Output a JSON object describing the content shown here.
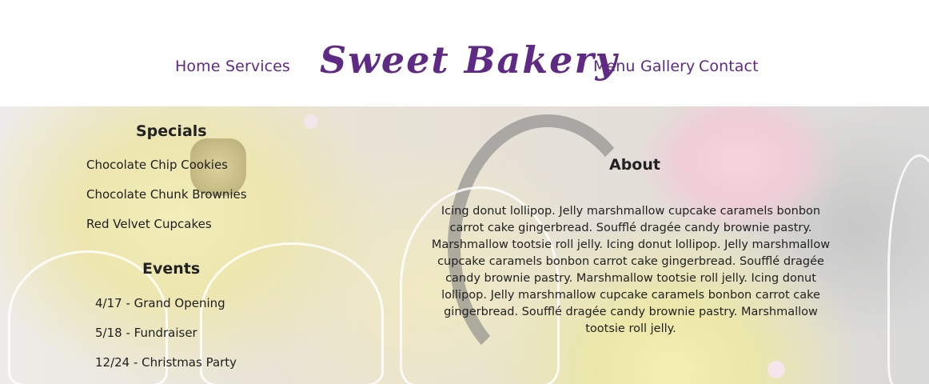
{
  "header": {
    "nav_left": [
      "Home",
      "Services"
    ],
    "brand": "Sweet Bakery",
    "nav_right": [
      "Menu",
      "Gallery",
      "Contact"
    ],
    "brand_color": "#5e2a84"
  },
  "specials": {
    "title": "Specials",
    "items": [
      "Chocolate Chip Cookies",
      "Chocolate Chunk Brownies",
      "Red Velvet Cupcakes"
    ]
  },
  "events": {
    "title": "Events",
    "items": [
      "4/17 - Grand Opening",
      "5/18 - Fundraiser",
      "12/24 - Christmas Party"
    ]
  },
  "about": {
    "title": "About",
    "text": "Icing donut lollipop. Jelly marshmallow cupcake caramels bonbon carrot cake gingerbread. Soufflé dragée candy brownie pastry. Marshmallow tootsie roll jelly. Icing donut lollipop. Jelly marshmallow cupcake caramels bonbon carrot cake gingerbread. Soufflé dragée candy brownie pastry. Marshmallow tootsie roll jelly. Icing donut lollipop. Jelly marshmallow cupcake caramels bonbon carrot cake gingerbread. Soufflé dragée candy brownie pastry. Marshmallow tootsie roll jelly."
  },
  "hero": {
    "image": "cupcakes-background"
  }
}
